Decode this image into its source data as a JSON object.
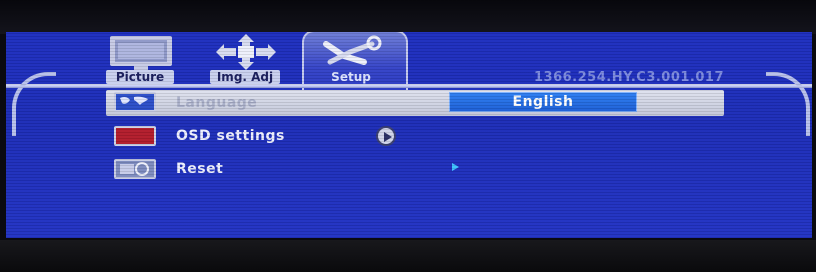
{
  "tabs": [
    {
      "label": "Picture",
      "icon": "monitor-icon",
      "active": false
    },
    {
      "label": "Img. Adj",
      "icon": "move-arrows-icon",
      "active": false
    },
    {
      "label": "Setup",
      "icon": "tools-icon",
      "active": true
    }
  ],
  "version": "1366.254.HY.C3.001.017",
  "menu": {
    "items": [
      {
        "label": "Language",
        "icon": "globe-icon",
        "value": "English",
        "selected": true
      },
      {
        "label": "OSD settings",
        "icon": "osd-icon"
      },
      {
        "label": "Reset",
        "icon": "reset-icon"
      }
    ]
  },
  "colors": {
    "screen_blue": "#1e2fc0",
    "selected_row": "#d4d8ea",
    "value_box": "#2a74ea",
    "tab_label_bg": "#c9d0ef"
  }
}
